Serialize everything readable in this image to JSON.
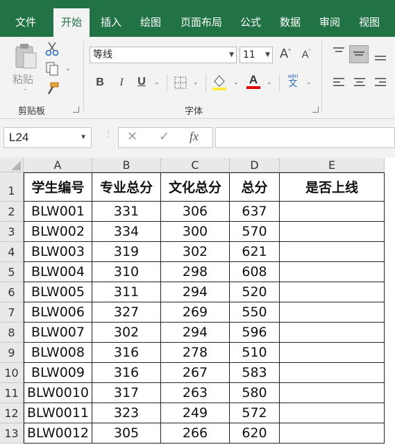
{
  "tabs": [
    "文件",
    "开始",
    "插入",
    "绘图",
    "页面布局",
    "公式",
    "数据",
    "审阅",
    "视图"
  ],
  "active_tab": "开始",
  "clipboard": {
    "paste_label": "粘贴",
    "group_label": "剪贴板"
  },
  "font": {
    "name": "等线",
    "size": "11",
    "group_label": "字体",
    "bold": "B",
    "italic": "I",
    "underline": "U",
    "font_color_letter": "A",
    "phonetic_top": "wén",
    "phonetic_bottom": "文",
    "grow": "A",
    "shrink": "A"
  },
  "colors": {
    "ribbon_green": "#217346",
    "font_color_bar": "#e00000",
    "fill_color_bar": "#ffeb3b"
  },
  "namebox": {
    "value": "L24"
  },
  "formula_bar": {
    "cancel": "✕",
    "confirm": "✓",
    "fx": "fx",
    "value": ""
  },
  "sheet": {
    "columns": [
      "A",
      "B",
      "C",
      "D",
      "E"
    ],
    "headers": [
      "学生编号",
      "专业总分",
      "文化总分",
      "总分",
      "是否上线"
    ],
    "rows": [
      [
        "BLW001",
        "331",
        "306",
        "637",
        ""
      ],
      [
        "BLW002",
        "334",
        "300",
        "570",
        ""
      ],
      [
        "BLW003",
        "319",
        "302",
        "621",
        ""
      ],
      [
        "BLW004",
        "310",
        "298",
        "608",
        ""
      ],
      [
        "BLW005",
        "311",
        "294",
        "520",
        ""
      ],
      [
        "BLW006",
        "327",
        "269",
        "550",
        ""
      ],
      [
        "BLW007",
        "302",
        "294",
        "596",
        ""
      ],
      [
        "BLW008",
        "316",
        "278",
        "510",
        ""
      ],
      [
        "BLW009",
        "316",
        "267",
        "583",
        ""
      ],
      [
        "BLW0010",
        "317",
        "263",
        "580",
        ""
      ],
      [
        "BLW0011",
        "323",
        "249",
        "572",
        ""
      ],
      [
        "BLW0012",
        "305",
        "266",
        "620",
        ""
      ]
    ],
    "row_numbers": [
      "1",
      "2",
      "3",
      "4",
      "5",
      "6",
      "7",
      "8",
      "9",
      "10",
      "11",
      "12",
      "13"
    ]
  }
}
